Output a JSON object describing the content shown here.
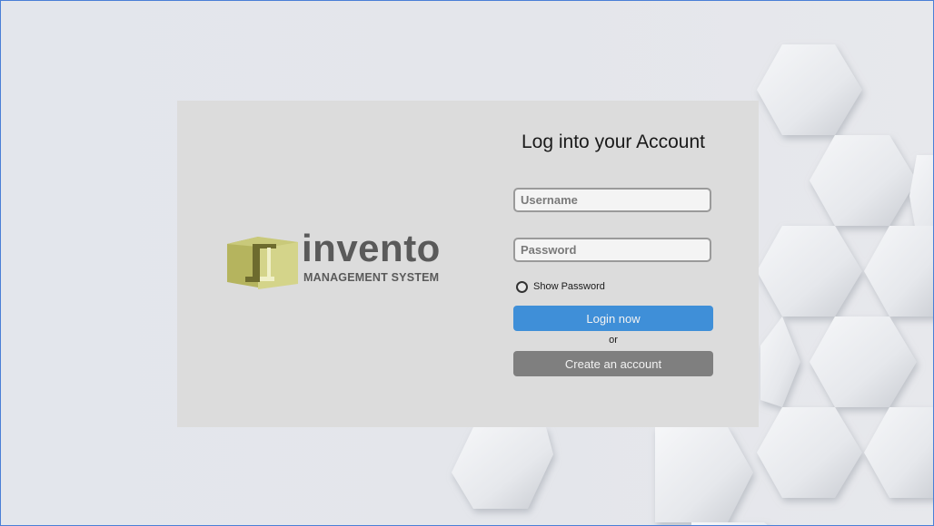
{
  "logo": {
    "word": "invento",
    "subtitle": "MANAGEMENT SYSTEM"
  },
  "form": {
    "title": "Log into your Account",
    "username_placeholder": "Username",
    "password_placeholder": "Password",
    "show_password_label": "Show Password",
    "login_label": "Login now",
    "or_text": "or",
    "create_label": "Create an account"
  },
  "colors": {
    "login_button": "#3f8fd8",
    "create_button": "#7f7f7f",
    "card_background": "#dcdcdc",
    "logo_mark": "#c8c86a"
  },
  "icons": {
    "logo_mark": "box-logo-icon",
    "show_password_toggle": "radio-circle-icon"
  }
}
